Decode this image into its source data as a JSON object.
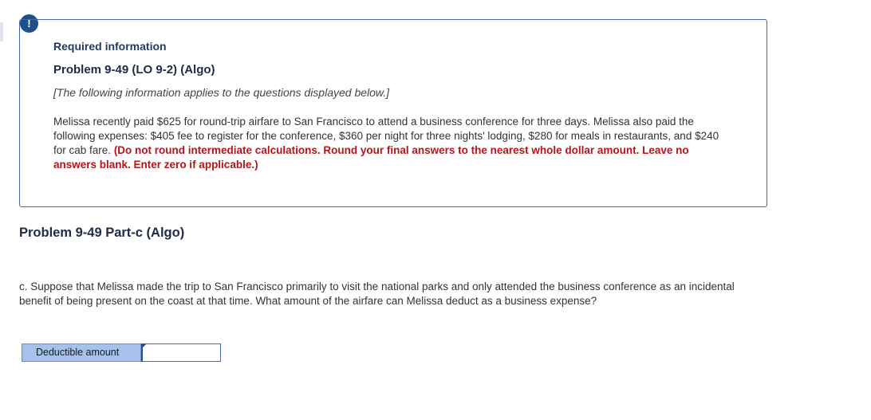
{
  "alert": {
    "icon": "exclamation-icon",
    "symbol": "!",
    "color": "#1f4e8c"
  },
  "info_box": {
    "heading": "Required information",
    "problem_title": "Problem 9-49 (LO 9-2) (Algo)",
    "applies_note": "[The following information applies to the questions displayed below.]",
    "scenario_text": "Melissa recently paid $625 for round-trip airfare to San Francisco to attend a business conference for three days. Melissa also paid the following expenses: $405 fee to register for the conference, $360 per night for three nights' lodging, $280 for meals in restaurants, and $240 for cab fare.",
    "instructions": "(Do not round intermediate calculations. Round your final answers to the nearest whole dollar amount. Leave no answers blank. Enter zero if applicable.)",
    "instructions_color": "#b3151a",
    "border_color": "#3f6aa8"
  },
  "part": {
    "title": "Problem 9-49 Part-c (Algo)",
    "question": "c. Suppose that Melissa made the trip to San Francisco primarily to visit the national parks and only attended the business conference as an incidental benefit of being present on the coast at that time. What amount of the airfare can Melissa deduct as a business expense?",
    "answer_label": "Deductible amount",
    "answer_value": "",
    "answer_label_bg": "#a6c2ea"
  }
}
